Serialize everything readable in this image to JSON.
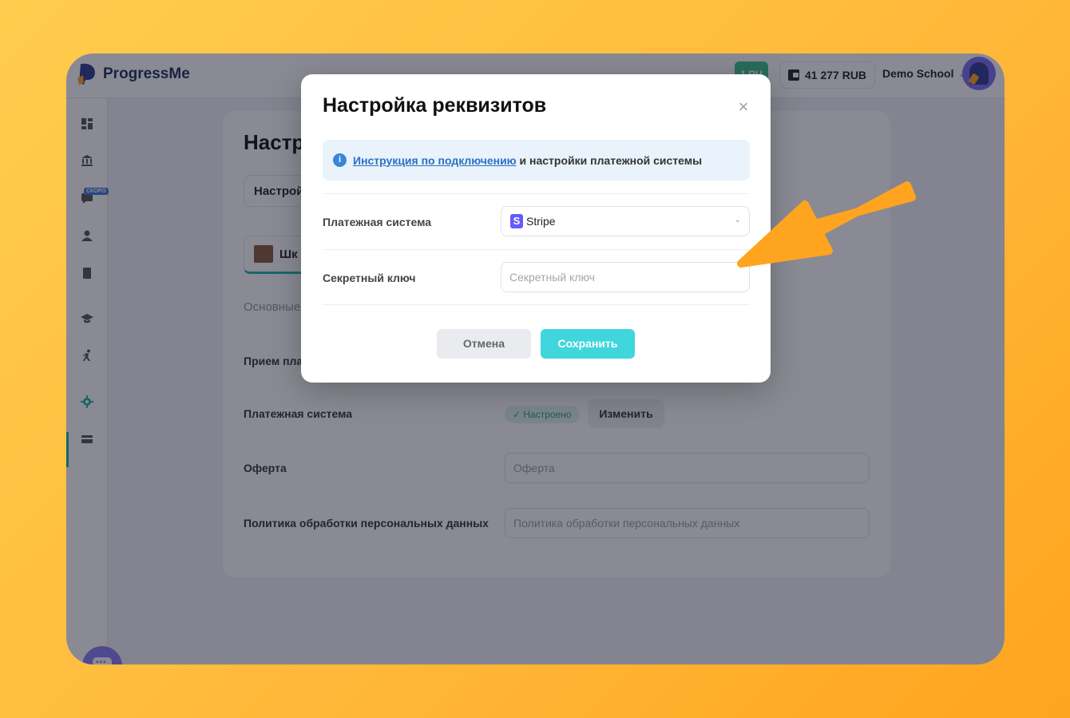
{
  "app": {
    "logo_text": "ProgressMe",
    "badge": "1 RU",
    "balance": "41 277 RUB",
    "school_name": "Demo School"
  },
  "sidebar": {
    "soon_badge": "СКОРО",
    "items": [
      {
        "icon": "dashboard-icon"
      },
      {
        "icon": "bank-icon"
      },
      {
        "icon": "chat-icon"
      },
      {
        "icon": "user-icon"
      },
      {
        "icon": "book-icon"
      },
      {
        "icon": "graduation-cap-icon"
      },
      {
        "icon": "running-icon"
      },
      {
        "icon": "gear-icon"
      },
      {
        "icon": "card-icon"
      }
    ]
  },
  "page": {
    "title": "Настр",
    "settings_tab": "Настрой",
    "school_tab": "Шк",
    "section": "Основные",
    "rows": {
      "payment_accept": "Прием плат",
      "payment_system": "Платежная система",
      "payment_status": "✓ Настроено",
      "change_button": "Изменить",
      "offer": "Оферта",
      "offer_placeholder": "Оферта",
      "privacy": "Политика обработки персональных данных",
      "privacy_placeholder": "Политика обработки персональных данных"
    }
  },
  "modal": {
    "title": "Настройка реквизитов",
    "info_link": "Инструкция по подключению",
    "info_rest": "и настройки платежной системы",
    "payment_system_label": "Платежная система",
    "payment_system_value": "Stripe",
    "secret_key_label": "Секретный ключ",
    "secret_key_placeholder": "Секретный ключ",
    "secret_key_value": "",
    "cancel": "Отмена",
    "save": "Сохранить"
  },
  "colors": {
    "accent": "#3fd6dc",
    "link": "#2a70c4",
    "arrow": "#ffa41f",
    "stripe": "#635bff"
  }
}
